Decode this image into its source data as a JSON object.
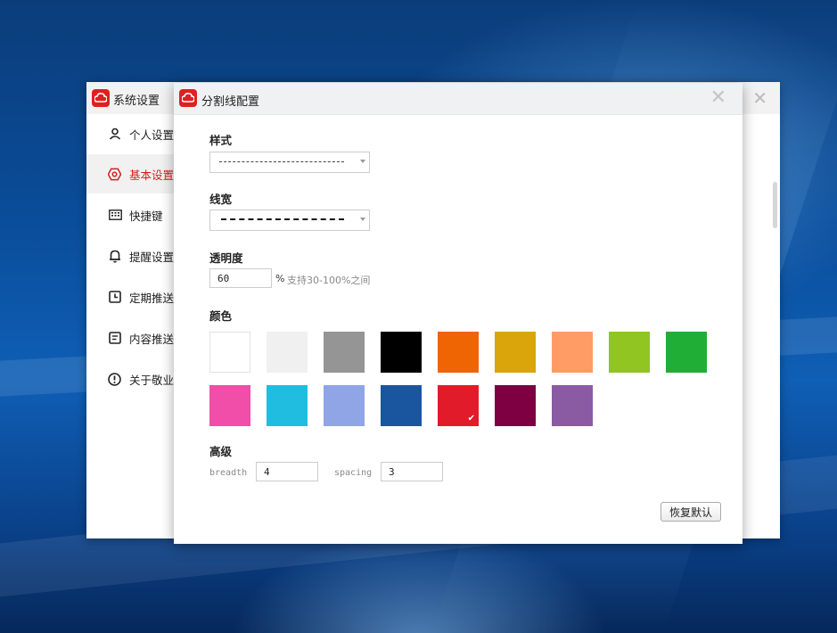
{
  "back_window": {
    "title": "系统设置",
    "sidebar": [
      {
        "label": "个人设置",
        "icon": "user-icon"
      },
      {
        "label": "基本设置",
        "icon": "settings-hex-icon",
        "active": true
      },
      {
        "label": "快捷键",
        "icon": "keyboard-icon"
      },
      {
        "label": "提醒设置",
        "icon": "bell-icon"
      },
      {
        "label": "定期推送",
        "icon": "clock-icon"
      },
      {
        "label": "内容推送",
        "icon": "document-icon"
      },
      {
        "label": "关于敬业",
        "icon": "info-icon"
      }
    ]
  },
  "dialog": {
    "title": "分割线配置",
    "style": {
      "label": "样式",
      "value": "dashed-thin"
    },
    "width": {
      "label": "线宽",
      "value": "dashed-thick"
    },
    "opacity": {
      "label": "透明度",
      "value": "60",
      "unit": "%",
      "hint": "支持30-100%之间"
    },
    "color": {
      "label": "颜色",
      "selected_index": 13,
      "swatches": [
        "#ffffff",
        "#f0f0f0",
        "#959595",
        "#000000",
        "#f06503",
        "#d9a50a",
        "#ff9c65",
        "#90c522",
        "#20ae36",
        "#f04ea8",
        "#20bde0",
        "#8fa5e6",
        "#1a56a0",
        "#e21b2b",
        "#7e0042",
        "#8a5aa3"
      ]
    },
    "advanced": {
      "label": "高级",
      "breadth_label": "breadth",
      "breadth_value": "4",
      "spacing_label": "spacing",
      "spacing_value": "3"
    },
    "reset_label": "恢复默认"
  },
  "colors": {
    "accent": "#d42020",
    "logo": "#e02020"
  }
}
